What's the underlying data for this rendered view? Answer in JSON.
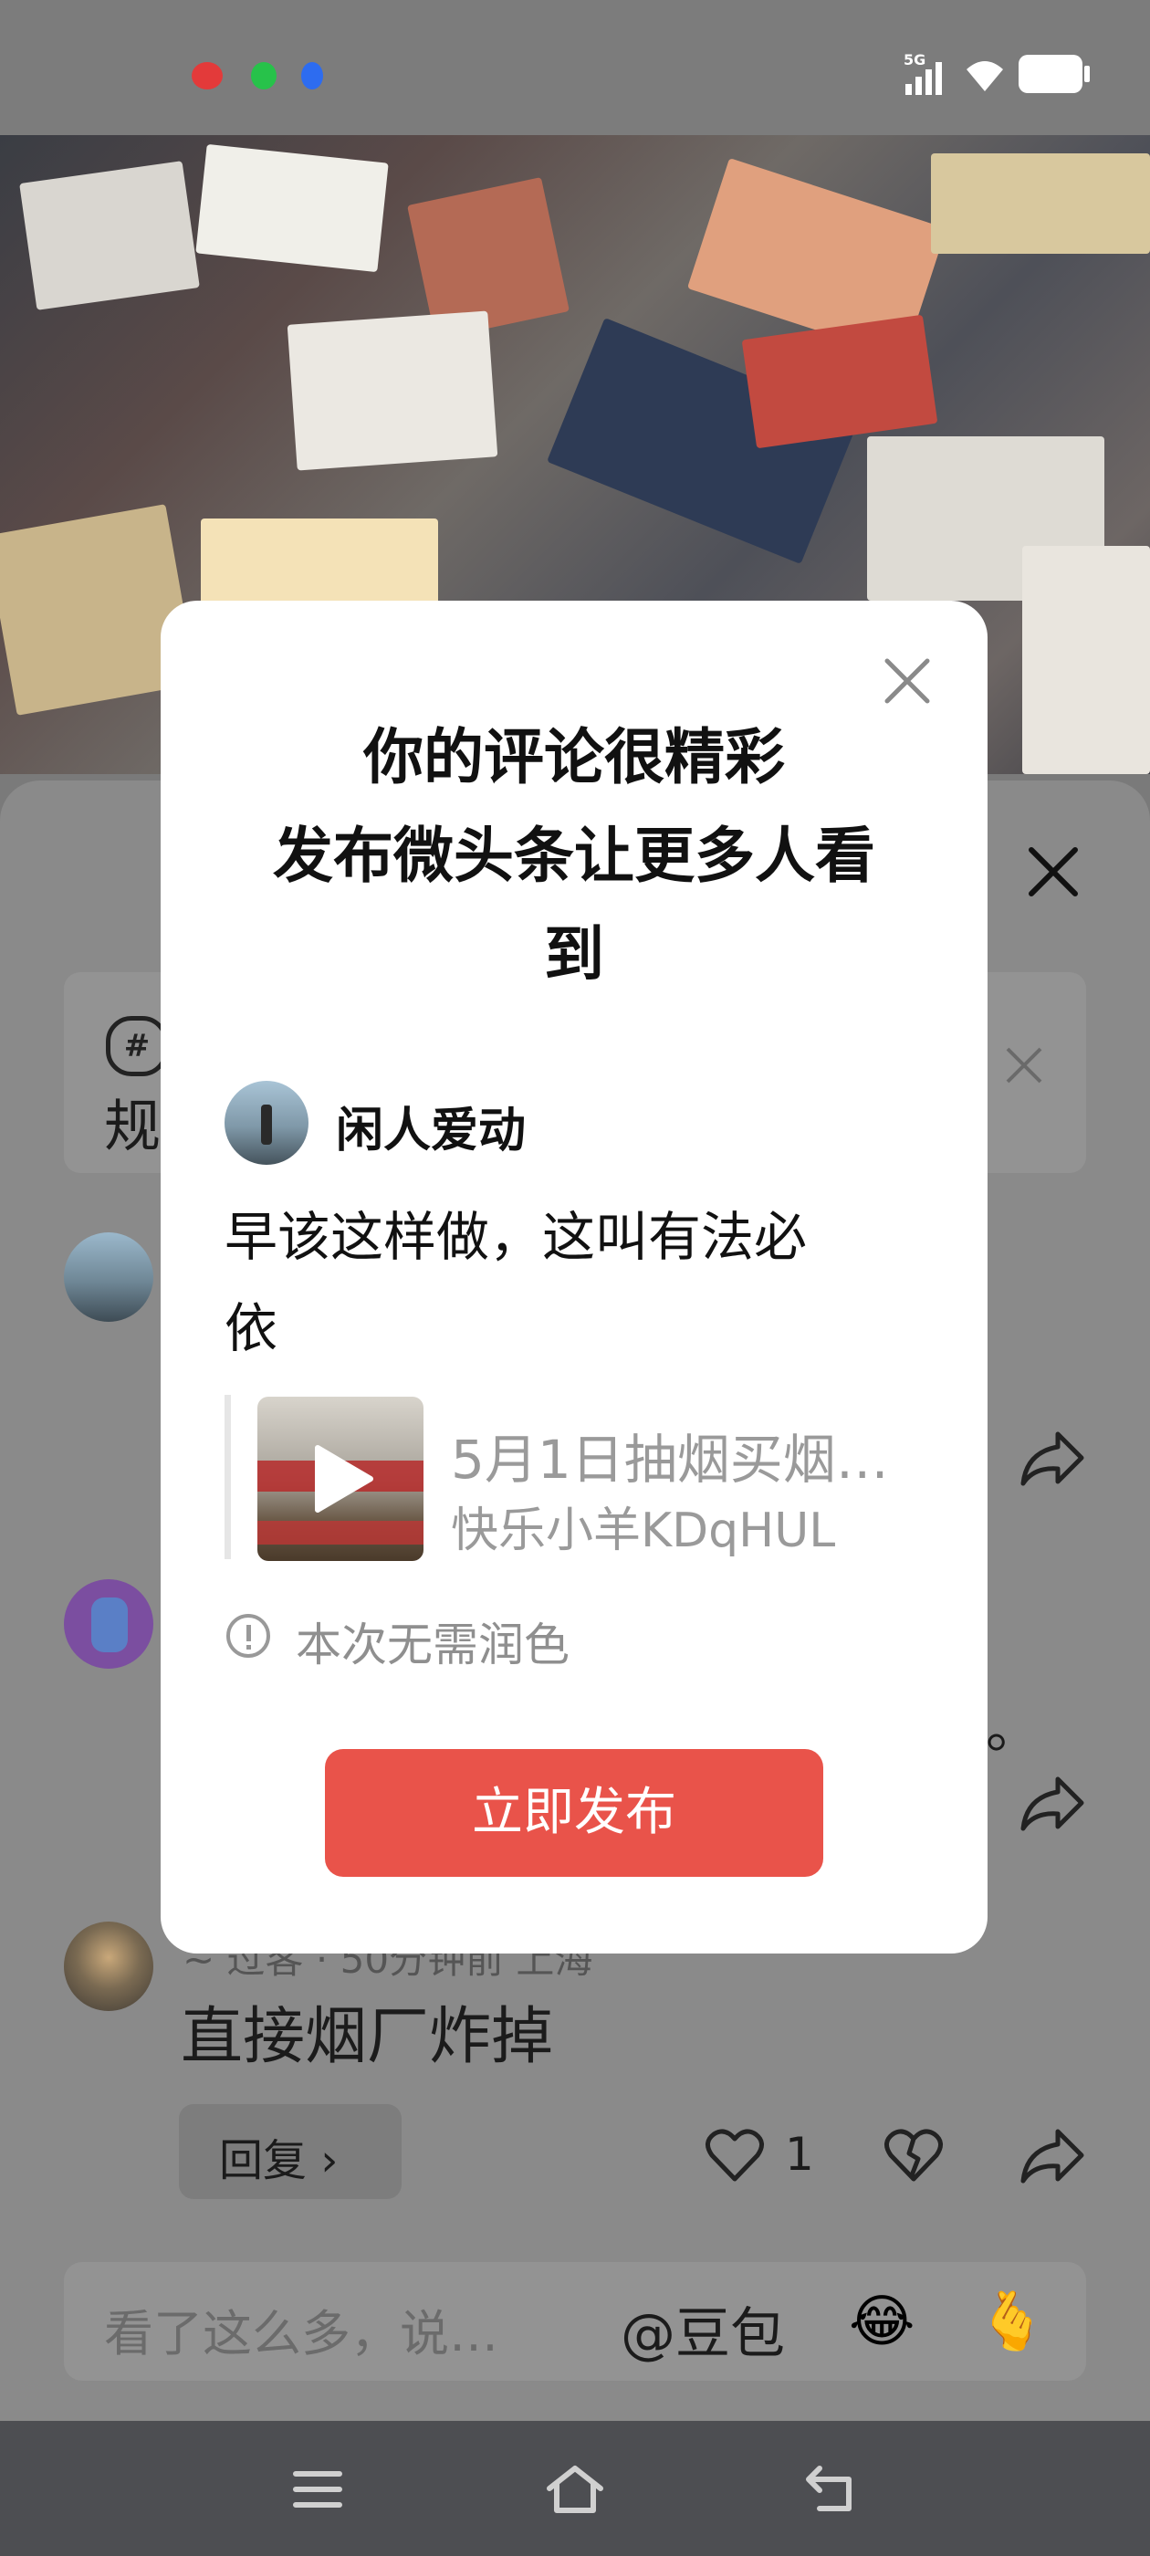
{
  "status_bar": {
    "network": "5G",
    "icons": [
      "signal-icon",
      "wifi-icon",
      "battery-icon"
    ],
    "notification_colors": [
      "#ff3b3b",
      "#2ecc40",
      "#2f6fff"
    ]
  },
  "sheet": {
    "topic_icon": "hashtag-icon",
    "topic_char": "规",
    "comments": [
      {
        "avatar": "avatar-landscape"
      },
      {
        "avatar": "avatar-purple-cartoon",
        "trail": "。"
      },
      {
        "meta": "~ 过客 · 50分钟前 上海",
        "text": "直接烟厂炸掉",
        "reply_label": "回复 ›",
        "likes": "1"
      }
    ],
    "input_placeholder": "看了这么多，说…",
    "at_button": "@豆包",
    "emoji_1": "😂",
    "emoji_2": "🫰"
  },
  "modal": {
    "title_line1": "你的评论很精彩",
    "title_line2": "发布微头条让更多人看",
    "title_line3": "到",
    "user_name": "闲人爱动",
    "comment_line1": "早该这样做，这叫有法必",
    "comment_line2": "依",
    "video_title": "5月1日抽烟买烟…",
    "video_author": "快乐小羊KDqHUL",
    "notice": "本次无需润色",
    "publish_button": "立即发布"
  },
  "colors": {
    "publish_button": "#e94e43",
    "overlay": "#7a7a7a",
    "modal_bg": "#ffffff"
  }
}
